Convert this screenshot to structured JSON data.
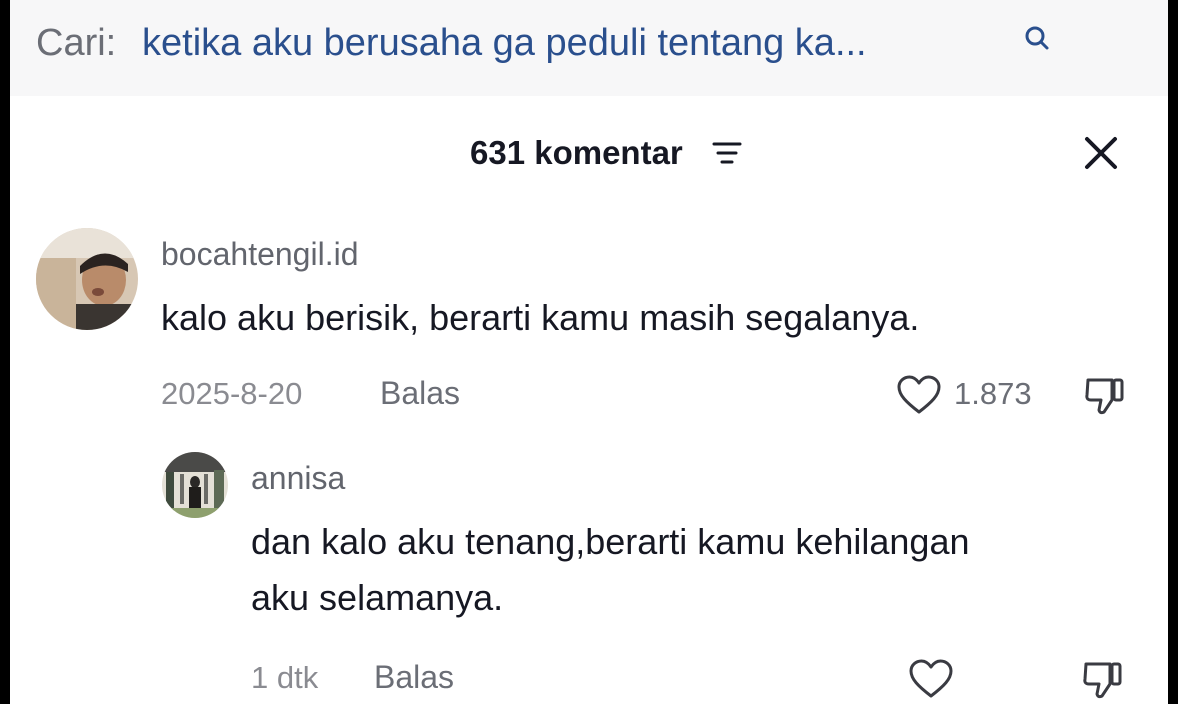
{
  "search": {
    "prefix": "Cari:",
    "query": "ketika aku berusaha ga peduli tentang ka..."
  },
  "header": {
    "comment_count": "631 komentar"
  },
  "icons": {
    "search": "search-icon",
    "filter": "filter-icon",
    "close": "close-icon",
    "like": "heart-icon",
    "dislike": "thumbs-down-icon"
  },
  "comments": [
    {
      "username": "bocahtengil.id",
      "text": "kalo aku berisik, berarti kamu masih segalanya.",
      "date": "2025-8-20",
      "reply_label": "Balas",
      "likes": "1.873"
    },
    {
      "username": "annisa",
      "text": "dan kalo aku tenang,berarti kamu kehilangan aku selamanya.",
      "date": "1 dtk",
      "reply_label": "Balas"
    }
  ],
  "colors": {
    "search_query": "#2a4f8d",
    "text_primary": "#161823",
    "text_secondary": "#62656d"
  }
}
